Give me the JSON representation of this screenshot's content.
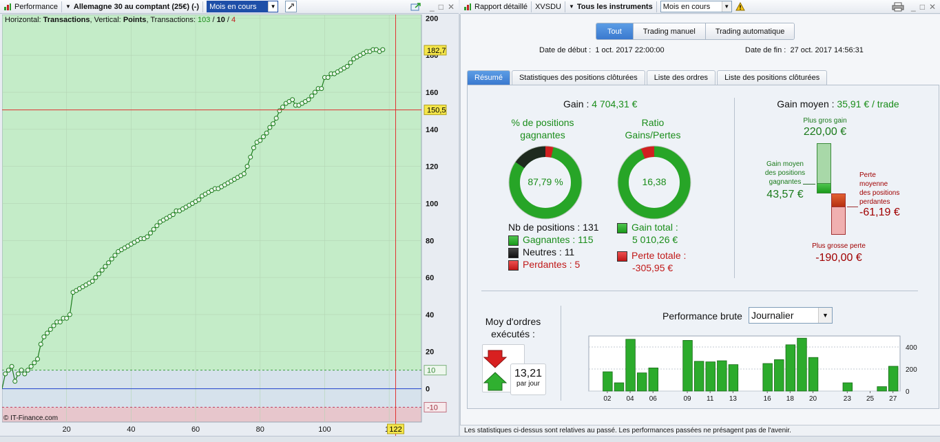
{
  "left_window": {
    "title": "Performance",
    "instrument": "Allemagne 30 au comptant (25€) (-)",
    "period": "Mois en cours",
    "chart_header": {
      "prefix": "Horizontal:",
      "horizontal": "Transactions",
      "vertical_prefix": ", Vertical:",
      "vertical": "Points",
      "transactions_prefix": ", Transactions:",
      "wins": "103",
      "sep1": " / ",
      "neutral": "10",
      "sep2": " / ",
      "losses": "4"
    },
    "copyright": "© IT-Finance.com",
    "crosshair_y_label": "150,5",
    "last_value_label": "182,7",
    "crosshair_x_label": "122",
    "band_upper_label": "10",
    "band_lower_label": "-10"
  },
  "right_window": {
    "report_label": "Rapport détaillé",
    "account": "XVSDU",
    "instruments_label": "Tous les instruments",
    "period": "Mois en cours",
    "segments": [
      "Tout",
      "Trading manuel",
      "Trading automatique"
    ],
    "date_start_label": "Date de début :",
    "date_start": "1 oct. 2017 22:00:00",
    "date_end_label": "Date de fin :",
    "date_end": "27 oct. 2017 14:56:31",
    "tabs": [
      "Résumé",
      "Statistiques des positions clôturées",
      "Liste des ordres",
      "Liste des positions clôturées"
    ],
    "summary": {
      "gain_label": "Gain :",
      "gain_value": "4 704,31 €",
      "pct_title_1": "% de positions",
      "pct_title_2": "gagnantes",
      "pct_value": "87,79 %",
      "ratio_title_1": "Ratio",
      "ratio_title_2": "Gains/Pertes",
      "ratio_value": "16,38",
      "nb_positions": "Nb de positions : 131",
      "winners": "Gagnantes : 115",
      "neutrals": "Neutres : 11",
      "losers": "Perdantes : 5",
      "total_gain_label": "Gain total :",
      "total_gain_value": "5 010,26 €",
      "total_loss_label": "Perte totale :",
      "total_loss_value": "-305,95 €",
      "avg_gain_label": "Gain moyen :",
      "avg_gain_value": "35,91 € / trade",
      "biggest_gain_label": "Plus gros gain",
      "biggest_gain_value": "220,00 €",
      "avg_win_label_1": "Gain moyen",
      "avg_win_label_2": "des positions",
      "avg_win_label_3": "gagnantes",
      "avg_win_value": "43,57 €",
      "avg_loss_label_1": "Perte",
      "avg_loss_label_2": "moyenne",
      "avg_loss_label_3": "des positions",
      "avg_loss_label_4": "perdantes",
      "avg_loss_value": "-61,19 €",
      "biggest_loss_label": "Plus grosse perte",
      "biggest_loss_value": "-190,00 €",
      "orders_title_1": "Moy d'ordres",
      "orders_title_2": "exécutés :",
      "orders_value": "13,21",
      "orders_unit": "par jour",
      "perf_title": "Performance brute",
      "perf_period": "Journalier"
    },
    "footer": "Les statistiques ci-dessus sont relatives au passé. Les performances passées ne présagent pas de l'avenir."
  },
  "colors": {
    "accent": "#3a79cf",
    "green": "#1a8d1a",
    "red": "#c01818",
    "crosshair": "#e03030",
    "zero_line": "#2040d0"
  },
  "chart_data": [
    {
      "type": "line",
      "xlabel": "Transactions",
      "ylabel": "Points",
      "xlim": [
        0,
        130
      ],
      "ylim": [
        -18,
        202
      ],
      "x_ticks": [
        20,
        40,
        60,
        80,
        100,
        120
      ],
      "x_tick_labels": [
        "20",
        "40",
        "60",
        "80",
        "100",
        "12"
      ],
      "y_ticks": [
        0,
        20,
        40,
        60,
        80,
        100,
        120,
        140,
        160,
        180,
        200
      ],
      "grid": true,
      "series": [
        {
          "x": [
            1,
            2,
            3,
            4,
            5,
            6,
            7,
            8,
            9,
            10,
            11,
            12,
            13,
            14,
            15,
            16,
            17,
            18,
            19,
            20,
            21,
            22,
            23,
            24,
            25,
            26,
            27,
            28,
            29,
            30,
            31,
            32,
            33,
            34,
            35,
            36,
            37,
            38,
            39,
            40,
            41,
            42,
            43,
            44,
            45,
            46,
            47,
            48,
            49,
            50,
            51,
            52,
            53,
            54,
            55,
            56,
            57,
            58,
            59,
            60,
            61,
            62,
            63,
            64,
            65,
            66,
            67,
            68,
            69,
            70,
            71,
            72,
            73,
            74,
            75,
            76,
            77,
            78,
            79,
            80,
            81,
            82,
            83,
            84,
            85,
            86,
            87,
            88,
            89,
            90,
            91,
            92,
            93,
            94,
            95,
            96,
            97,
            98,
            99,
            100,
            101,
            102,
            103,
            104,
            105,
            106,
            107,
            108,
            109,
            110,
            111,
            112,
            113,
            114,
            115,
            116,
            117,
            118
          ],
          "y": [
            8,
            10,
            12,
            4,
            8,
            10,
            8,
            10,
            12,
            14,
            16,
            24,
            28,
            30,
            32,
            34,
            36,
            36,
            38,
            38,
            40,
            52,
            53,
            54,
            55,
            56,
            57,
            58,
            60,
            62,
            64,
            66,
            68,
            70,
            72,
            74,
            75,
            76,
            77,
            78,
            79,
            80,
            81,
            81,
            82,
            84,
            86,
            88,
            90,
            91,
            92,
            93,
            94,
            96,
            96,
            97,
            98,
            99,
            100,
            101,
            102,
            104,
            105,
            106,
            107,
            108,
            108,
            109,
            110,
            111,
            112,
            113,
            114,
            115,
            116,
            120,
            125,
            130,
            133,
            134,
            136,
            138,
            141,
            143,
            146,
            150,
            152,
            154,
            155,
            156,
            153,
            153,
            154,
            155,
            156,
            158,
            160,
            162,
            162,
            168,
            168,
            170,
            170,
            171,
            172,
            173,
            174,
            176,
            178,
            179,
            180,
            181,
            182,
            182,
            183,
            183,
            182,
            183
          ]
        }
      ],
      "annotations": [
        "150,5",
        "182,7",
        "122",
        "10",
        "-10"
      ]
    },
    {
      "type": "bar",
      "title": "Performance brute",
      "categories": [
        "01",
        "02",
        "03",
        "04",
        "05",
        "06",
        "07",
        "08",
        "09",
        "10",
        "11",
        "12",
        "13",
        "14",
        "15",
        "16",
        "17",
        "18",
        "19",
        "20",
        "21",
        "22",
        "23",
        "24",
        "25",
        "26",
        "27"
      ],
      "x_tick_labels": [
        "02",
        "04",
        "06",
        "09",
        "11",
        "13",
        "16",
        "18",
        "20",
        "23",
        "25",
        "27"
      ],
      "values": [
        0,
        175,
        75,
        470,
        165,
        210,
        0,
        0,
        460,
        270,
        265,
        275,
        240,
        0,
        0,
        250,
        285,
        420,
        480,
        305,
        0,
        0,
        75,
        0,
        0,
        40,
        225
      ],
      "ylim": [
        0,
        500
      ],
      "y_ticks": [
        0,
        200,
        400
      ],
      "grid": true
    }
  ]
}
